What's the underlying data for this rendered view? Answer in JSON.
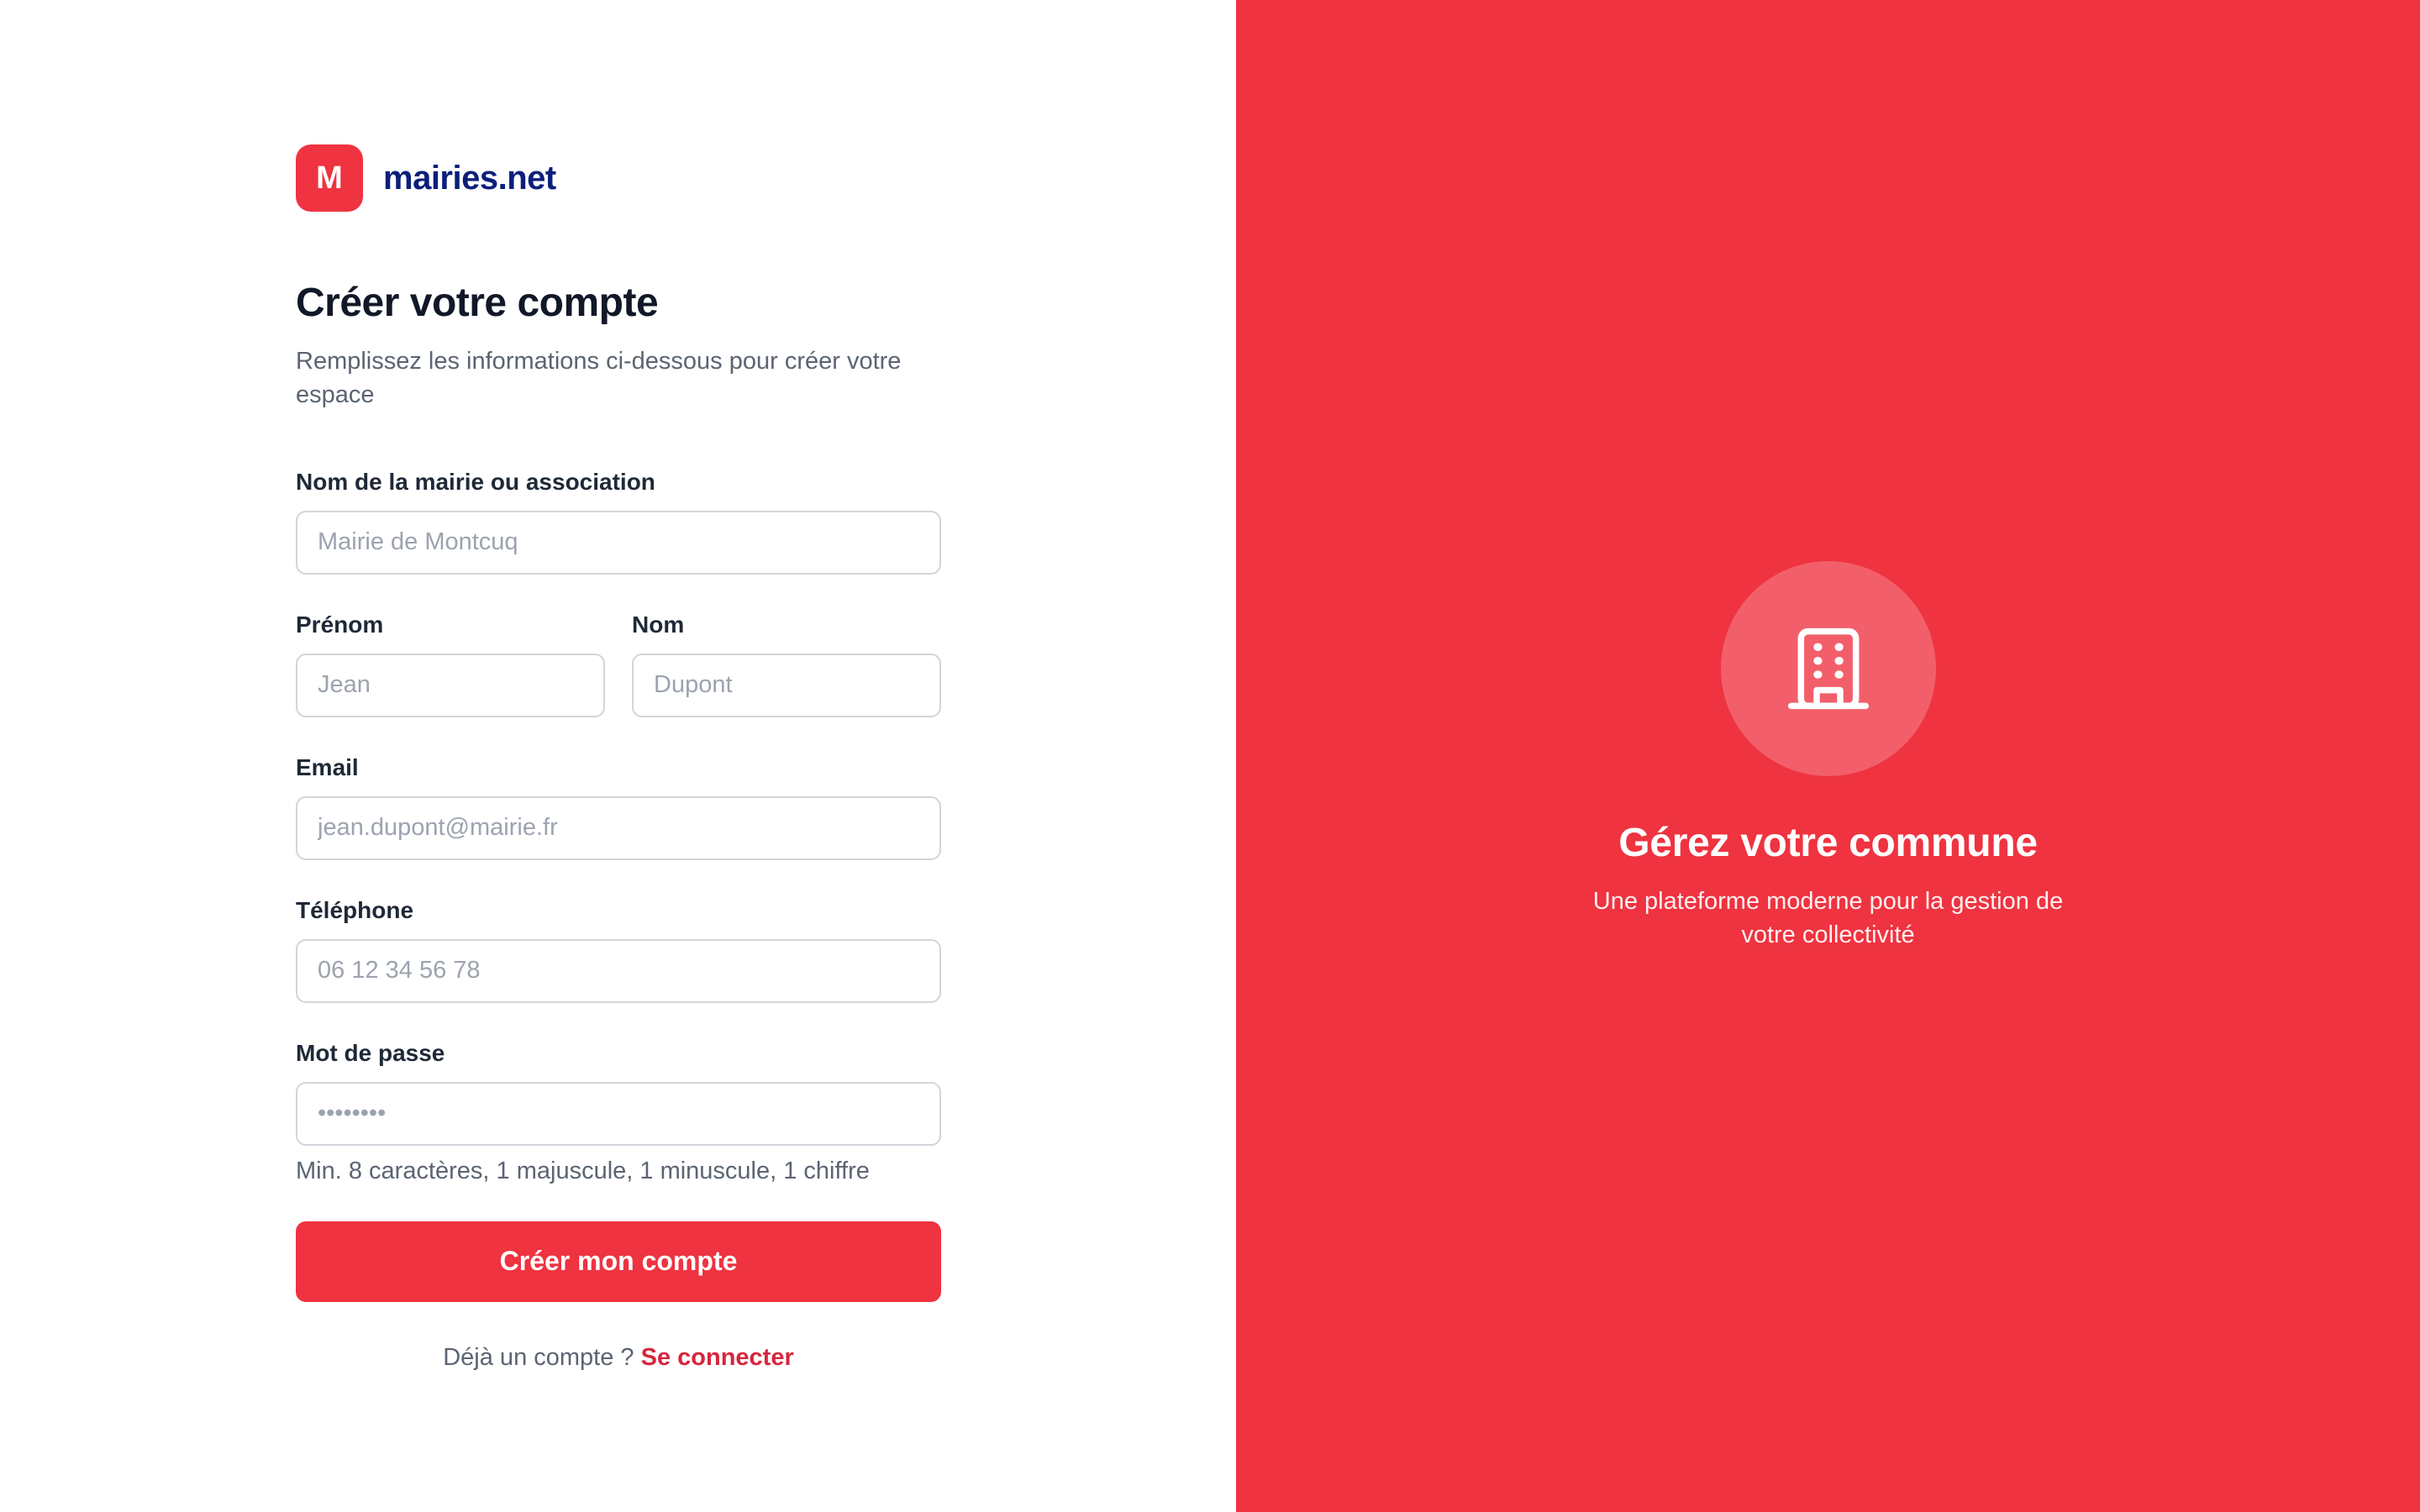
{
  "brand": {
    "logo_letter": "M",
    "name": "mairies.net"
  },
  "form": {
    "title": "Créer votre compte",
    "subtitle": "Remplissez les informations ci-dessous pour créer votre espace",
    "org": {
      "label": "Nom de la mairie ou association",
      "placeholder": "Mairie de Montcuq"
    },
    "firstname": {
      "label": "Prénom",
      "placeholder": "Jean"
    },
    "lastname": {
      "label": "Nom",
      "placeholder": "Dupont"
    },
    "email": {
      "label": "Email",
      "placeholder": "jean.dupont@mairie.fr"
    },
    "phone": {
      "label": "Téléphone",
      "placeholder": "06 12 34 56 78"
    },
    "password": {
      "label": "Mot de passe",
      "placeholder": "••••••••",
      "hint": "Min. 8 caractères, 1 majuscule, 1 minuscule, 1 chiffre"
    },
    "submit_label": "Créer mon compte",
    "login_prompt": "Déjà un compte ?",
    "login_link": "Se connecter"
  },
  "hero": {
    "icon": "building-icon",
    "title": "Gérez votre commune",
    "subtitle": "Une plateforme moderne pour la gestion de votre collectivité"
  },
  "colors": {
    "accent": "#ef3340",
    "brand_text": "#0b1f7a",
    "link": "#d7263d"
  }
}
